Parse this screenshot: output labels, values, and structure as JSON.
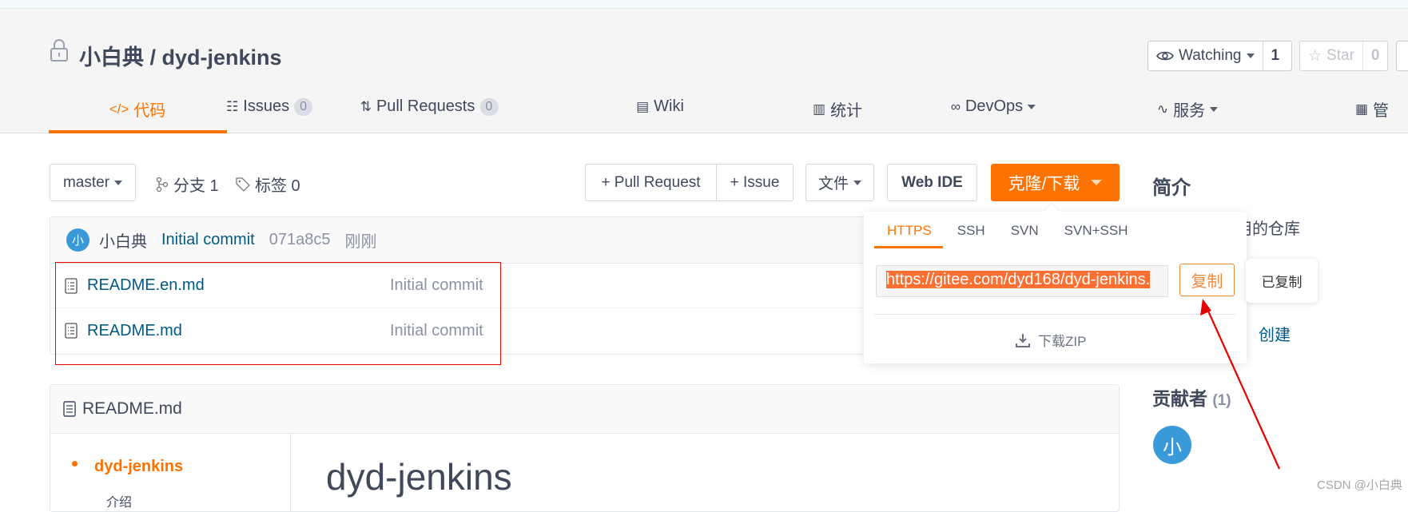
{
  "repo": {
    "title": "小白典 / dyd-jenkins"
  },
  "actions": {
    "watch_label": "Watching",
    "watch_count": "1",
    "star_label": "Star",
    "star_count": "0"
  },
  "tabs": [
    {
      "label": "代码",
      "icon": "code-icon",
      "active": true
    },
    {
      "label": "Issues",
      "badge": "0",
      "icon": "issues-icon"
    },
    {
      "label": "Pull Requests",
      "badge": "0",
      "icon": "pull-request-icon"
    },
    {
      "label": "Wiki",
      "icon": "book-icon"
    },
    {
      "label": "统计",
      "icon": "bar-chart-icon"
    },
    {
      "label": "DevOps",
      "icon": "infinity-icon",
      "dropdown": true
    },
    {
      "label": "服务",
      "icon": "pulse-icon",
      "dropdown": true
    },
    {
      "label": "管",
      "icon": "settings-doc-icon"
    }
  ],
  "toolbar": {
    "branch": "master",
    "branches": "分支 1",
    "tags": "标签 0",
    "pull_request": "+ Pull Request",
    "issue": "+ Issue",
    "file": "文件",
    "web_ide": "Web IDE",
    "clone": "克隆/下载"
  },
  "commit": {
    "avatar": "小",
    "author": "小白典",
    "message": "Initial commit",
    "hash": "071a8c5",
    "time": "刚刚"
  },
  "files": [
    {
      "name": "README.en.md",
      "commit": "Initial commit"
    },
    {
      "name": "README.md",
      "commit": "Initial commit"
    }
  ],
  "clone_popup": {
    "tabs": [
      "HTTPS",
      "SSH",
      "SVN",
      "SVN+SSH"
    ],
    "active_tab": "HTTPS",
    "url": "https://gitee.com/dyd168/dyd-jenkins.",
    "copy": "复制",
    "download_zip": "下载ZIP",
    "tooltip": "已复制"
  },
  "sidebar": {
    "intro_title": "简介",
    "intro_text": "用的仓库",
    "create_link": "创建",
    "contributors_title": "贡献者",
    "contributors_count": "(1)",
    "contributor_avatar": "小"
  },
  "readme": {
    "filename": "README.md",
    "toc": [
      "dyd-jenkins",
      "介绍"
    ],
    "heading": "dyd-jenkins"
  },
  "watermark": "CSDN @小白典",
  "colors": {
    "accent": "#fe7300",
    "link": "#005980",
    "annotation": "#e60000"
  }
}
